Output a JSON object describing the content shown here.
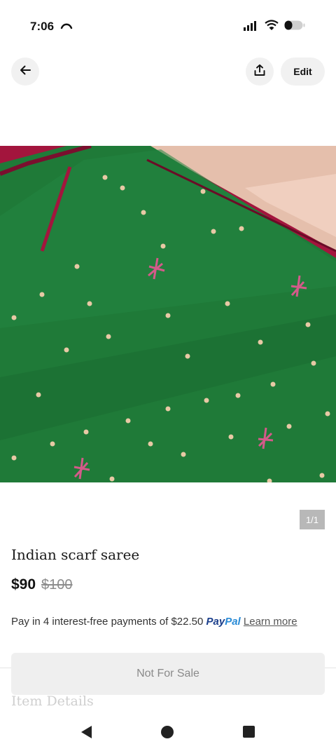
{
  "status_bar": {
    "time": "7:06",
    "icons": [
      "missed-call-icon",
      "signal-icon",
      "wifi-icon",
      "battery-icon"
    ]
  },
  "top_bar": {
    "back_icon": "arrow-left-icon",
    "share_icon": "share-upload-icon",
    "edit_label": "Edit"
  },
  "gallery": {
    "counter": "1/1",
    "colors": {
      "saree_green": "#1f7a38",
      "border_red": "#b0163e",
      "background_peach": "#e8c1ae"
    }
  },
  "listing": {
    "title": "Indian scarf saree",
    "price": "$90",
    "original_price": "$100",
    "paypal": {
      "prefix": "Pay in 4 interest-free payments of $22.50",
      "logo_pay": "Pay",
      "logo_pal": "Pal",
      "learn_more": "Learn more"
    },
    "status_button": "Not For Sale",
    "details_heading": "Item Details"
  },
  "nav_bar": {
    "icons": [
      "nav-back-icon",
      "nav-home-icon",
      "nav-recents-icon"
    ]
  }
}
